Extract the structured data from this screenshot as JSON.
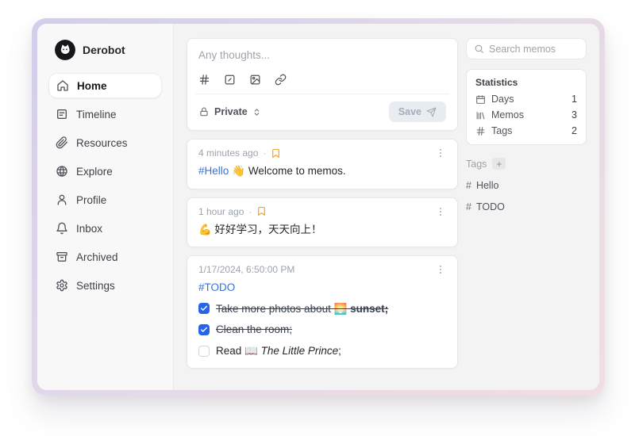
{
  "colors": {
    "accent_blue": "#3572d9",
    "checkbox_blue": "#2563eb",
    "bookmark_amber": "#f59e0b",
    "frame_gradient_start": "#d4cdeb",
    "frame_gradient_end": "#f2dde2"
  },
  "sidebar": {
    "user": {
      "name": "Derobot"
    },
    "items": [
      {
        "label": "Home",
        "active": true
      },
      {
        "label": "Timeline",
        "active": false
      },
      {
        "label": "Resources",
        "active": false
      },
      {
        "label": "Explore",
        "active": false
      },
      {
        "label": "Profile",
        "active": false
      },
      {
        "label": "Inbox",
        "active": false
      },
      {
        "label": "Archived",
        "active": false
      },
      {
        "label": "Settings",
        "active": false
      }
    ]
  },
  "composer": {
    "placeholder": "Any thoughts...",
    "visibility_label": "Private",
    "save_label": "Save"
  },
  "memos": [
    {
      "timestamp": "4 minutes ago",
      "separator": "·",
      "tag": "#Hello",
      "text": "👋 Welcome to memos."
    },
    {
      "timestamp": "1 hour ago",
      "separator": "·",
      "text": "💪 好好学习，天天向上！"
    },
    {
      "timestamp": "1/17/2024, 6:50:00 PM",
      "tag": "#TODO",
      "tasks": [
        {
          "pre": "Take more photos about 🌅 ",
          "bold": "sunset;",
          "checked": true
        },
        {
          "pre": "Clean the room;",
          "checked": true
        },
        {
          "pre": "Read 📖 ",
          "em": "The Little Prince",
          "post": ";",
          "checked": false
        }
      ]
    }
  ],
  "search": {
    "placeholder": "Search memos"
  },
  "statistics": {
    "title": "Statistics",
    "rows": [
      {
        "label": "Days",
        "value": "1"
      },
      {
        "label": "Memos",
        "value": "3"
      },
      {
        "label": "Tags",
        "value": "2"
      }
    ]
  },
  "tags": {
    "title": "Tags",
    "add_label": "+",
    "items": [
      {
        "prefix": "#",
        "label": "Hello"
      },
      {
        "prefix": "#",
        "label": "TODO"
      }
    ]
  }
}
